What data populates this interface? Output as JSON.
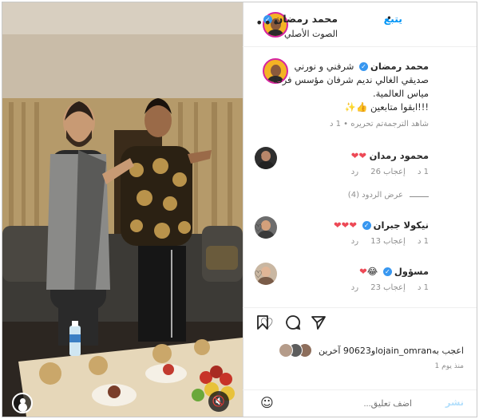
{
  "post": {
    "username": "محمد رمضان",
    "follow_label": "يتبع",
    "dot": "•",
    "audio_label": "الصوت الأصلي",
    "more_icon": "more-icon"
  },
  "caption": {
    "username": "محمد رمضان",
    "text": "شرفني و نورني صديقي الغالي نديم شرفان مؤسس فرقة مياس العالمية.",
    "text2": "!!!ابقوا متابعين",
    "emoji": "👍✨",
    "see_translation": "شاهد الترجمة",
    "edited": "تم تحريره",
    "dot": "•",
    "time": "1 د"
  },
  "comments": [
    {
      "username": "محمود رمدان",
      "hearts": 2,
      "emoji": "",
      "time": "1 د",
      "likes": "إعجاب 26",
      "reply": "رد"
    },
    {
      "username": "نيكولا جبران",
      "hearts": 3,
      "emoji": "",
      "time": "1 د",
      "likes": "إعجاب 13",
      "reply": "رد"
    },
    {
      "username": "مسؤول",
      "hearts": 1,
      "emoji": "😂",
      "time": "1 د",
      "likes": "إعجاب 23",
      "reply": "رد"
    }
  ],
  "view_replies": "عرض الردود (4)",
  "likes_text": "اعجب بهlojain_omranو90623 آخرين",
  "timestamp": "منذ يوم 1",
  "add_comment": {
    "placeholder": "اضف تعليق...",
    "post_label": "نشر"
  },
  "icons": {
    "like": "heart-outline-icon",
    "comment": "comment-icon",
    "share": "send-icon",
    "save": "bookmark-icon",
    "mute": "mute-icon",
    "emoji": "smiley-icon"
  }
}
